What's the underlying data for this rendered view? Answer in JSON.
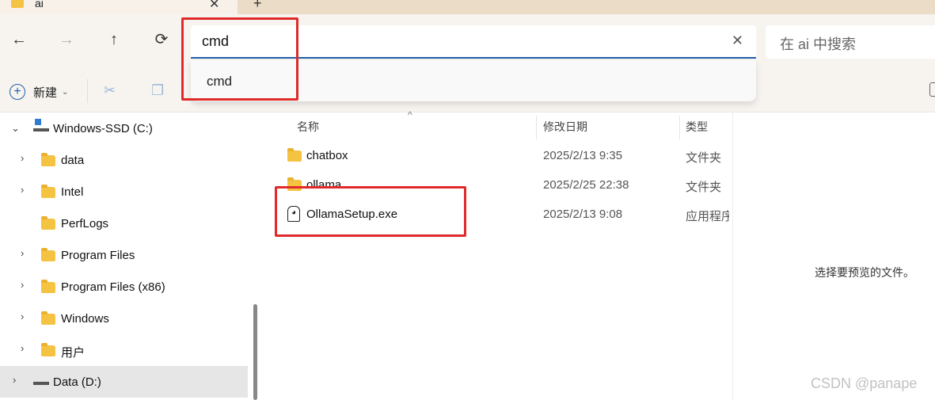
{
  "tab": {
    "title": "ai",
    "close": "✕",
    "new": "+"
  },
  "nav": {
    "back": "←",
    "forward": "→",
    "up": "↑",
    "refresh": "⟳"
  },
  "address": {
    "value": "cmd",
    "clear": "✕"
  },
  "search": {
    "placeholder": "在 ai 中搜索"
  },
  "suggestion": {
    "item": "cmd"
  },
  "toolbar": {
    "new_label": "新建",
    "new_chevron": "⌄"
  },
  "sidebar": {
    "items": [
      {
        "label": "Windows-SSD (C:)",
        "chevron": "⌄"
      },
      {
        "label": "data",
        "chevron": "›"
      },
      {
        "label": "Intel",
        "chevron": "›"
      },
      {
        "label": "PerfLogs",
        "chevron": ""
      },
      {
        "label": "Program Files",
        "chevron": "›"
      },
      {
        "label": "Program Files (x86)",
        "chevron": "›"
      },
      {
        "label": "Windows",
        "chevron": "›"
      },
      {
        "label": "用户",
        "chevron": "›"
      },
      {
        "label": "Data (D:)",
        "chevron": "›"
      }
    ]
  },
  "columns": {
    "name": "名称",
    "modified": "修改日期",
    "type": "类型"
  },
  "files": [
    {
      "name": "chatbox",
      "date": "2025/2/13 9:35",
      "type": "文件夹",
      "icon": "folder-icon"
    },
    {
      "name": "ollama",
      "date": "2025/2/25 22:38",
      "type": "文件夹",
      "icon": "folder-icon"
    },
    {
      "name": "OllamaSetup.exe",
      "date": "2025/2/13 9:08",
      "type": "应用程序",
      "icon": "ollama-app-icon"
    }
  ],
  "preview": {
    "message": "选择要预览的文件。"
  },
  "watermark": "CSDN @panape",
  "colors": {
    "accent": "#1f5fa8",
    "highlight_box": "#e02a2a",
    "folder": "#f5c342"
  }
}
